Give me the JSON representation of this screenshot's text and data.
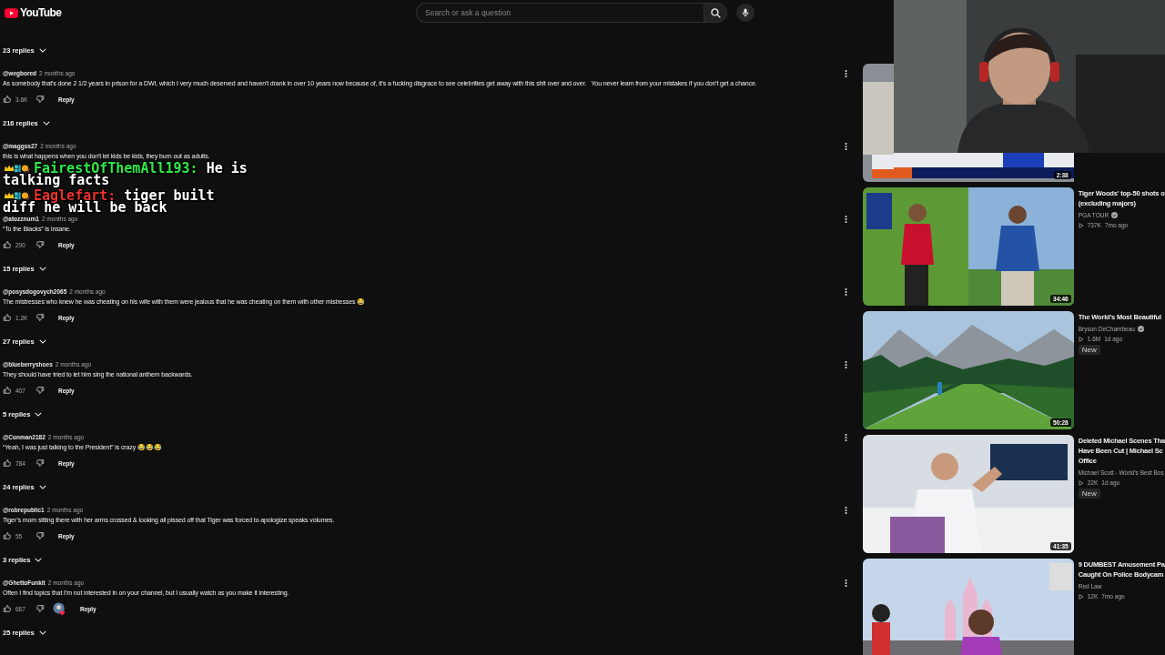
{
  "topbar": {
    "logo": "YouTube",
    "search": {
      "placeholder": "Search or ask a question"
    }
  },
  "comments_section": {
    "leading_replies": "23 replies",
    "comments": [
      {
        "author": "@wegbored",
        "time": "2 months ago",
        "text": "As somebody that's done 2 1/2 years in prison for a DWI, which I very much deserved and haven't drank in over 10 years now because of, it's a fucking disgrace to see celebrities get away with this shit over and over.   You never learn from your mistakes if you don't get a chance.",
        "likes": "3.6K",
        "creator_heart": false,
        "reply": "Reply",
        "replies": "216 replies"
      },
      {
        "author": "@maggss27",
        "time": "2 months ago",
        "text": "this is what happens when you don't let kids be kids, they burn out as adults."
      },
      {
        "author": "@atozznum1",
        "time": "2 months ago",
        "text": "“To the Blacks” is insane.",
        "likes": "290",
        "creator_heart": false,
        "reply": "Reply",
        "replies": "15 replies"
      },
      {
        "author": "@posysdogovych2065",
        "time": "2 months ago",
        "text": "The mistresses who knew he was cheating on his wife with them were jealous that he was cheating on them with other mistresses 😂",
        "likes": "1.2K",
        "creator_heart": false,
        "reply": "Reply",
        "replies": "27 replies"
      },
      {
        "author": "@blueberryshoes",
        "time": "2 months ago",
        "text": "They should have tried to let him sing the national anthem backwards.",
        "likes": "407",
        "creator_heart": false,
        "reply": "Reply",
        "replies": "5 replies"
      },
      {
        "author": "@Conman2182",
        "time": "2 months ago",
        "text": "“Yeah, I was just talking to the President” is crazy 😂😂😂",
        "likes": "784",
        "creator_heart": false,
        "reply": "Reply",
        "replies": "24 replies"
      },
      {
        "author": "@robrepublic1",
        "time": "2 months ago",
        "text": "Tiger’s mom sitting there with her arms crossed & looking all pissed off that Tiger was forced to apologize speaks volumes.",
        "likes": "55",
        "creator_heart": false,
        "reply": "Reply",
        "replies": "3 replies"
      },
      {
        "author": "@GhettoFunkit",
        "time": "2 months ago",
        "text": "Often I find topics that I’m not interested in on your channel, but I usually watch as you make it interesting.",
        "likes": "667",
        "creator_heart": true,
        "reply": "Reply",
        "replies": "25 replies"
      }
    ]
  },
  "chat_overlay": [
    {
      "name": "FairestOfThemAll193:",
      "color": "#2ee84a",
      "message_lines": [
        "He is",
        "talking facts"
      ]
    },
    {
      "name": "Eaglefart:",
      "color": "#e8322e",
      "message_lines": [
        "tiger built",
        "diff he will be back"
      ]
    }
  ],
  "sidebar": {
    "videos": [
      {
        "kind": "picture",
        "duration": "2:38"
      },
      {
        "kind": "picture",
        "title_lines": [
          "Tiger Woods' top-50 shots o",
          "(excluding majors)"
        ],
        "channel": "PGA TOUR",
        "verified": true,
        "views": "737K",
        "age": "7mo ago",
        "duration": "34:46"
      },
      {
        "kind": "picture",
        "title_lines": [
          "The World's Most Beautiful"
        ],
        "channel": "Bryson DeChambeau",
        "verified": true,
        "views": "1.6M",
        "age": "1d ago",
        "badge": "New",
        "duration": "50:28"
      },
      {
        "kind": "picture",
        "title_lines": [
          "Deleted Michael Scenes Tha",
          "Have Been Cut | Michael Sc",
          "Office"
        ],
        "channel": "Michael Scott - World's Best Bos",
        "verified": false,
        "views": "22K",
        "age": "1d ago",
        "badge": "New",
        "duration": "41:35"
      },
      {
        "kind": "picture",
        "title_lines": [
          "9 DUMBEST Amusement Pa",
          "Caught On Police Bodycam"
        ],
        "channel": "Red Law",
        "verified": false,
        "views": "12K",
        "age": "7mo ago"
      }
    ]
  }
}
